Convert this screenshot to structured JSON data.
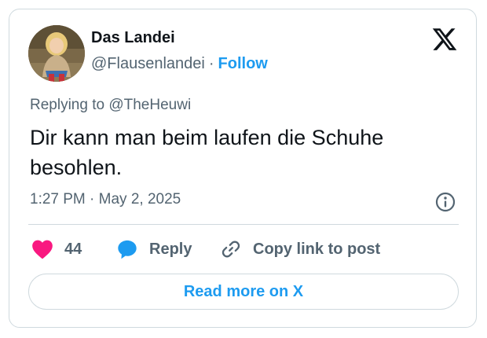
{
  "post": {
    "author": {
      "name": "Das Landei",
      "handle": "@Flausenlandei",
      "separator": "·",
      "follow_label": "Follow",
      "avatar_icon": "profile-photo"
    },
    "platform_icon": "x-logo-icon",
    "replying_to": "Replying to @TheHeuwi",
    "text": "Dir kann man beim laufen die Schuhe besohlen.",
    "timestamp": "1:27 PM · May 2, 2025",
    "info_icon": "info-icon"
  },
  "actions": {
    "like_count": "44",
    "reply_label": "Reply",
    "copy_link_label": "Copy link to post"
  },
  "cta": {
    "read_more_label": "Read more on X"
  },
  "colors": {
    "accent": "#1d9bf0",
    "like": "#f91880",
    "text_primary": "#0f1419",
    "text_secondary": "#536471",
    "border": "#cfd9de"
  }
}
